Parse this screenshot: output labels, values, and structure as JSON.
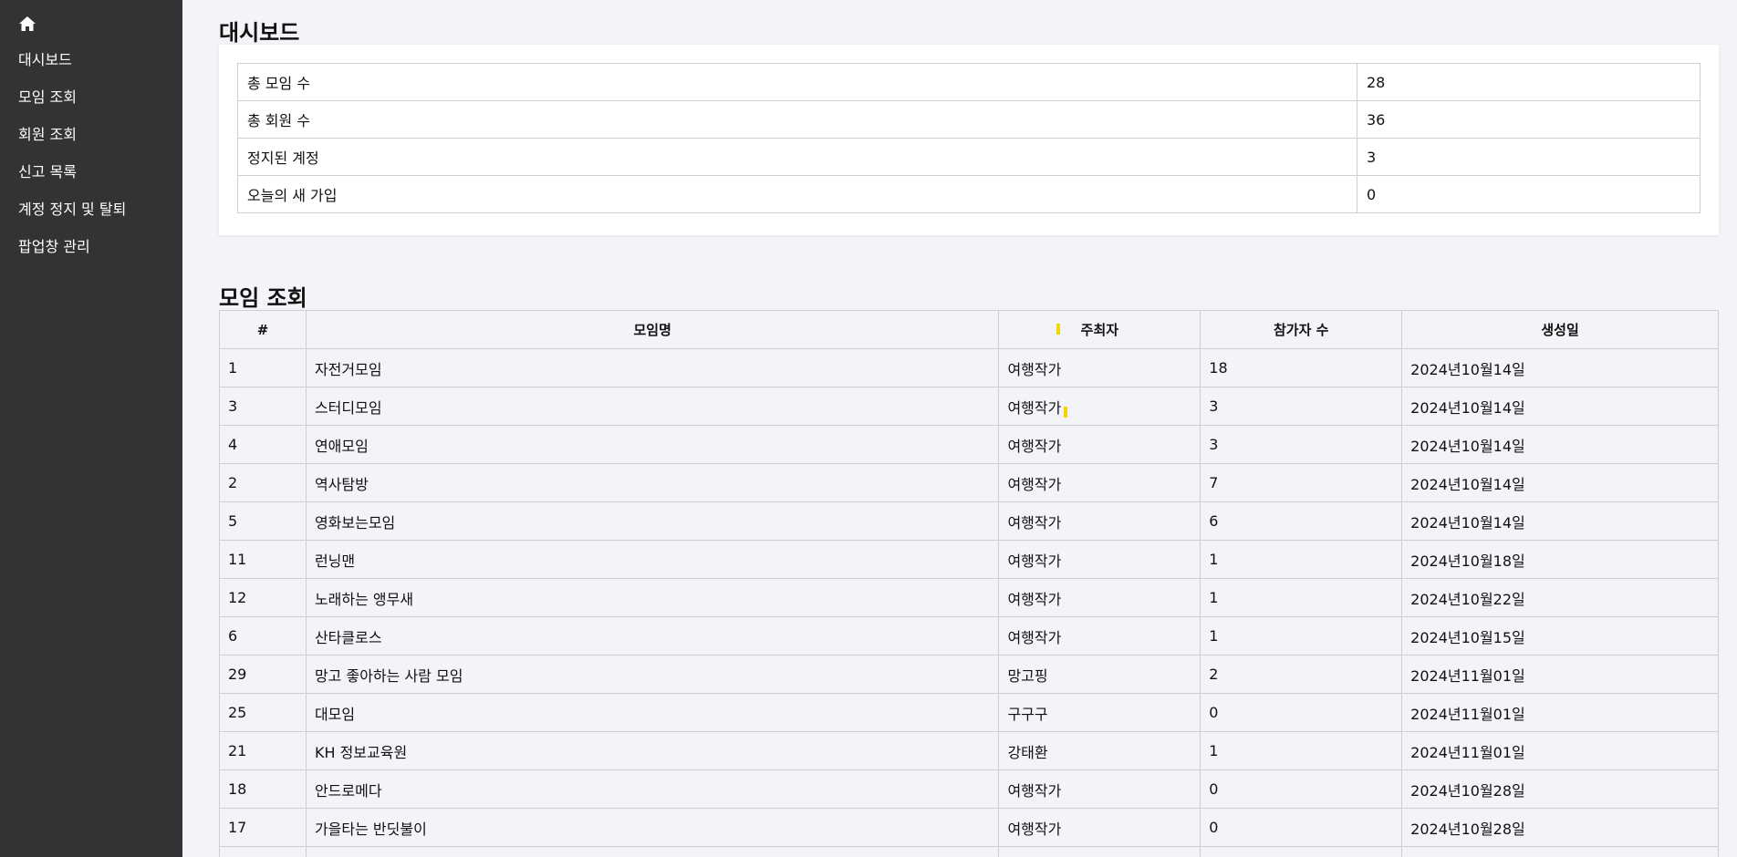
{
  "sidebar": {
    "home_icon": "home-icon",
    "items": [
      {
        "label": "대시보드"
      },
      {
        "label": "모임 조회"
      },
      {
        "label": "회원 조회"
      },
      {
        "label": "신고 목록"
      },
      {
        "label": "계정 정지 및 탈퇴"
      },
      {
        "label": "팝업창 관리"
      }
    ]
  },
  "dashboard": {
    "title": "대시보드",
    "stats": [
      {
        "label": "총 모임 수",
        "value": "28"
      },
      {
        "label": "총 회원 수",
        "value": "36"
      },
      {
        "label": "정지된 계정",
        "value": "3"
      },
      {
        "label": "오늘의 새 가입",
        "value": "0"
      }
    ]
  },
  "meetings": {
    "title": "모임 조회",
    "headers": [
      "#",
      "모임명",
      "주최자",
      "참가자 수",
      "생성일"
    ],
    "rows": [
      {
        "id": "1",
        "name": "자전거모임",
        "host": "여행작가",
        "count": "18",
        "date": "2024년10월14일"
      },
      {
        "id": "3",
        "name": "스터디모임",
        "host": "여행작가",
        "count": "3",
        "date": "2024년10월14일"
      },
      {
        "id": "4",
        "name": "연애모임",
        "host": "여행작가",
        "count": "3",
        "date": "2024년10월14일"
      },
      {
        "id": "2",
        "name": "역사탐방",
        "host": "여행작가",
        "count": "7",
        "date": "2024년10월14일"
      },
      {
        "id": "5",
        "name": "영화보는모임",
        "host": "여행작가",
        "count": "6",
        "date": "2024년10월14일"
      },
      {
        "id": "11",
        "name": "런닝맨",
        "host": "여행작가",
        "count": "1",
        "date": "2024년10월18일"
      },
      {
        "id": "12",
        "name": "노래하는 앵무새",
        "host": "여행작가",
        "count": "1",
        "date": "2024년10월22일"
      },
      {
        "id": "6",
        "name": "산타클로스",
        "host": "여행작가",
        "count": "1",
        "date": "2024년10월15일"
      },
      {
        "id": "29",
        "name": "망고 좋아하는 사람 모임",
        "host": "망고핑",
        "count": "2",
        "date": "2024년11월01일"
      },
      {
        "id": "25",
        "name": "대모임",
        "host": "구구구",
        "count": "0",
        "date": "2024년11월01일"
      },
      {
        "id": "21",
        "name": "KH 정보교육원",
        "host": "강태환",
        "count": "1",
        "date": "2024년11월01일"
      },
      {
        "id": "18",
        "name": "안드로메다",
        "host": "여행작가",
        "count": "0",
        "date": "2024년10월28일"
      },
      {
        "id": "17",
        "name": "가을타는 반딧불이",
        "host": "여행작가",
        "count": "0",
        "date": "2024년10월28일"
      },
      {
        "id": "",
        "name": "",
        "host": "",
        "count": "",
        "date": ""
      }
    ]
  },
  "colors": {
    "sidebar_bg": "#333333",
    "page_bg": "#f4f4f8",
    "border": "#cfcfcf",
    "marker": "#f2d600"
  }
}
